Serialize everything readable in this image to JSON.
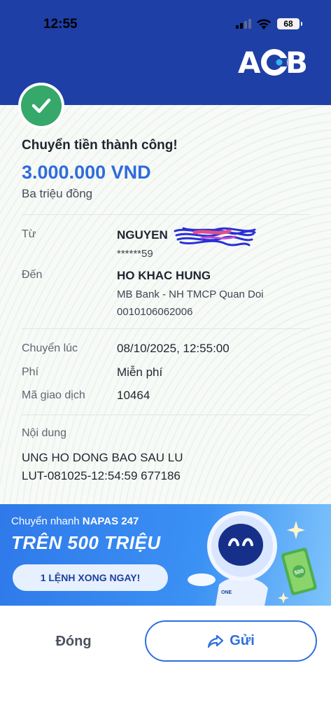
{
  "status_bar": {
    "time": "12:55",
    "battery": "68"
  },
  "header": {
    "logo": "ACB"
  },
  "receipt": {
    "title": "Chuyển tiền thành công!",
    "amount": "3.000.000 VND",
    "amount_words": "Ba triệu đồng",
    "from": {
      "label": "Từ",
      "name": "NGUYEN",
      "account": "******59"
    },
    "to": {
      "label": "Đến",
      "name": "HO KHAC HUNG",
      "bank": "MB Bank - NH TMCP Quan Doi",
      "account": "0010106062006"
    },
    "time": {
      "label": "Chuyển lúc",
      "value": "08/10/2025, 12:55:00"
    },
    "fee": {
      "label": "Phí",
      "value": "Miễn phí"
    },
    "transaction_id": {
      "label": "Mã giao dịch",
      "value": "10464"
    },
    "memo": {
      "label": "Nội dung",
      "line1": "UNG HO DONG BAO SAU LU",
      "line2": "LUT-081025-12:54:59 677186"
    }
  },
  "banner": {
    "prefix": "Chuyển nhanh ",
    "brand": "NAPAS 247",
    "headline": "TRÊN 500 TRIỆU",
    "button": "1 LỆNH XONG NGAY!",
    "mascot_text": "500"
  },
  "actions": {
    "close": "Đóng",
    "send": "Gửi"
  },
  "colors": {
    "header": "#1e3fa6",
    "success": "#35a86a",
    "amount": "#2f6bdc",
    "accent": "#2d6fe0"
  }
}
